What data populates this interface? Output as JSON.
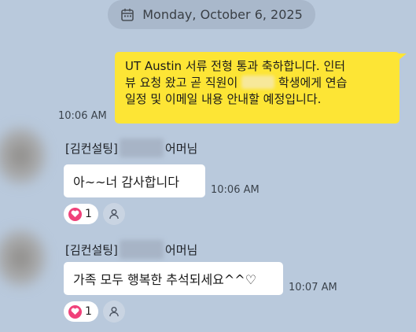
{
  "date_divider": {
    "label": "Monday, October 6, 2025",
    "icon": "calendar-icon"
  },
  "outgoing": {
    "line1_prefix": "UT Austin 서류 전형 통과 축하합니다. 인터",
    "line2_prefix": "뷰 요청 왔고 곧 직원이",
    "line2_suffix": "학생에게 연습",
    "line3": "일정 및 이메일 내용 안내할 예정입니다.",
    "time": "10:06 AM"
  },
  "messages": [
    {
      "sender_prefix": "[김컨설팅]",
      "sender_suffix": "어머님",
      "text": "아~~너 감사합니다",
      "time": "10:06 AM",
      "reaction_count": "1"
    },
    {
      "sender_prefix": "[김컨설팅]",
      "sender_suffix": "어머님",
      "text": "가족 모두 행복한 추석되세요^^♡",
      "time": "10:07 AM",
      "reaction_count": "1"
    }
  ],
  "colors": {
    "background": "#b9c9dc",
    "my_bubble": "#fde535",
    "heart": "#f0417a"
  }
}
